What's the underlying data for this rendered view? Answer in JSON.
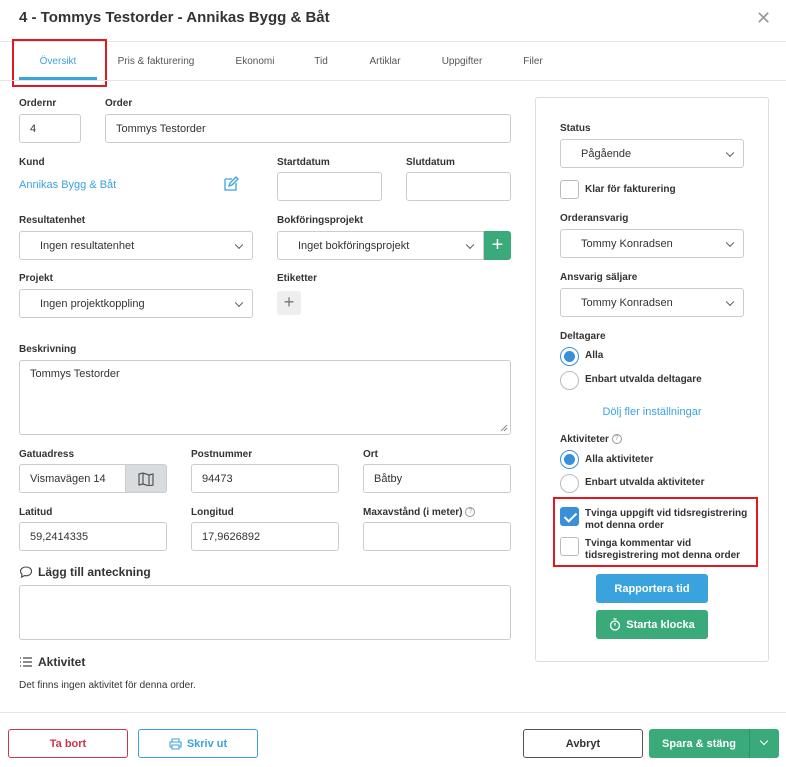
{
  "dialog": {
    "title": "4 - Tommys Testorder - Annikas Bygg & Båt"
  },
  "tabs": [
    "Översikt",
    "Pris & fakturering",
    "Ekonomi",
    "Tid",
    "Artiklar",
    "Uppgifter",
    "Filer"
  ],
  "form": {
    "ordernr_label": "Ordernr",
    "ordernr_value": "4",
    "order_label": "Order",
    "order_value": "Tommys Testorder",
    "kund_label": "Kund",
    "kund_value": "Annikas Bygg & Båt",
    "startdatum_label": "Startdatum",
    "slutdatum_label": "Slutdatum",
    "resultatenhet_label": "Resultatenhet",
    "resultatenhet_value": "Ingen resultatenhet",
    "bokforingsprojekt_label": "Bokföringsprojekt",
    "bokforingsprojekt_value": "Inget bokföringsprojekt",
    "projekt_label": "Projekt",
    "projekt_value": "Ingen projektkoppling",
    "etiketter_label": "Etiketter",
    "beskrivning_label": "Beskrivning",
    "beskrivning_value": "Tommys Testorder",
    "gatuadress_label": "Gatuadress",
    "gatuadress_value": "Vismavägen 14",
    "postnummer_label": "Postnummer",
    "postnummer_value": "94473",
    "ort_label": "Ort",
    "ort_value": "Båtby",
    "latitud_label": "Latitud",
    "latitud_value": "59,2414335",
    "longitud_label": "Longitud",
    "longitud_value": "17,9626892",
    "maxavstand_label": "Maxavstånd (i meter)",
    "anteckning_title": "Lägg till anteckning",
    "aktivitet_title": "Aktivitet",
    "aktivitet_empty": "Det finns ingen aktivitet för denna order."
  },
  "panel": {
    "status_label": "Status",
    "status_value": "Pågående",
    "klar_label": "Klar för fakturering",
    "orderansvarig_label": "Orderansvarig",
    "orderansvarig_value": "Tommy Konradsen",
    "saljare_label": "Ansvarig säljare",
    "saljare_value": "Tommy Konradsen",
    "deltagare_label": "Deltagare",
    "deltagare_all": "Alla",
    "deltagare_selected": "Enbart utvalda deltagare",
    "hide_settings": "Dölj fler inställningar",
    "aktiviteter_label": "Aktiviteter",
    "aktiviteter_all": "Alla aktiviteter",
    "aktiviteter_selected": "Enbart utvalda aktiviteter",
    "force_task_line1": "Tvinga uppgift vid tidsregistrering",
    "force_task_line2": "mot denna order",
    "force_comment_line1": "Tvinga kommentar vid",
    "force_comment_line2": "tidsregistrering mot denna order",
    "report_time": "Rapportera tid",
    "start_clock": "Starta klocka"
  },
  "footer": {
    "delete": "Ta bort",
    "print": "Skriv ut",
    "cancel": "Avbryt",
    "save_close": "Spara & stäng"
  },
  "colors": {
    "accent": "#3aa3dd",
    "green": "#3aaa7a",
    "red_highlight": "#e0191f",
    "delete_border": "#c9364b"
  }
}
